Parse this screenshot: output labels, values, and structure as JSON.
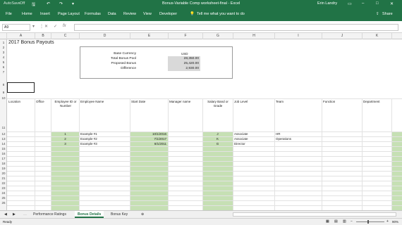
{
  "window": {
    "autosave": "AutoSave",
    "autosave_state": "Off",
    "title": "Bonus-Variable Comp worksheet-final - Excel",
    "user": "Erin Landry"
  },
  "ribbon": {
    "tabs": [
      "File",
      "Home",
      "Insert",
      "Page Layout",
      "Formulas",
      "Data",
      "Review",
      "View",
      "Developer"
    ],
    "tell_me": "Tell me what you want to do",
    "share": "Share"
  },
  "formula_bar": {
    "name_box": "A9",
    "formula": ""
  },
  "columns": [
    "A",
    "B",
    "C",
    "D",
    "E",
    "F",
    "G",
    "H",
    "I",
    "J",
    "K"
  ],
  "rows": [
    "1",
    "2",
    "3",
    "4",
    "5",
    "6",
    "7",
    "8",
    "9",
    "10",
    "11",
    "12",
    "13",
    "14",
    "15",
    "16",
    "17",
    "18",
    "19",
    "20",
    "21",
    "22",
    "23",
    "24",
    "25",
    "26"
  ],
  "sheet": {
    "title": "2017 Bonus Payouts",
    "summary": {
      "base_currency_label": "Base Currency",
      "base_currency_value": "USD",
      "total_pool_label": "Total Bonus Pool",
      "total_pool_value": "28,350.00",
      "proposed_label": "Proposed Bonus",
      "proposed_value": "25,420.00",
      "difference_label": "Difference",
      "difference_value": "2,930.00"
    },
    "headers": {
      "location": "Location",
      "office": "Office",
      "employee_id": "Employee ID or Number",
      "employee_name": "Employee Name",
      "start_date": "Start Date",
      "manager": "Manager name",
      "salary_band": "Salary Band or Grade",
      "job_level": "Job Level",
      "team": "Team",
      "function": "Function",
      "department": "Department"
    },
    "employees": [
      {
        "id": "1",
        "name": "Example #1",
        "start": "10/1/2016",
        "band": "J",
        "level": "Associate",
        "team": "HR"
      },
      {
        "id": "2",
        "name": "Example #2",
        "start": "7/1/2017",
        "band": "K",
        "level": "Associate",
        "team": "Operations"
      },
      {
        "id": "3",
        "name": "Example #3",
        "start": "8/1/2011",
        "band": "G",
        "level": "Director",
        "team": ""
      }
    ]
  },
  "sheet_tabs": [
    "Performance Ratings",
    "Bonus Details",
    "Bonus Key"
  ],
  "active_tab": "Bonus Details",
  "status": {
    "mode": "Ready",
    "zoom": "90%"
  },
  "colors": {
    "excel_green": "#217346",
    "input_fill": "#c6e0b4",
    "summary_fill": "#d9d9d9"
  }
}
